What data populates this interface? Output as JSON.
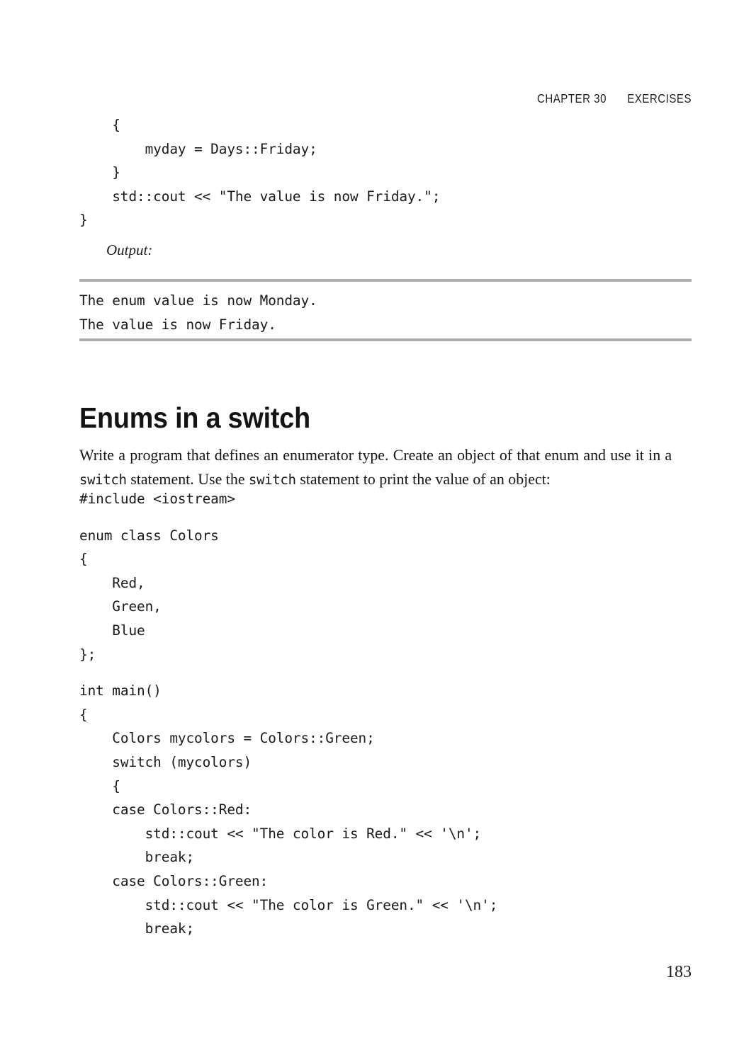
{
  "header": {
    "chapter": "CHAPTER 30",
    "section": "EXERCISES"
  },
  "code_top": {
    "lines": [
      "    {",
      "        myday = Days::Friday;",
      "    }",
      "    std::cout << \"The value is now Friday.\";",
      "}"
    ]
  },
  "output": {
    "label": "Output:",
    "lines": [
      "The enum value is now Monday.",
      "The value is now Friday."
    ],
    "rule_color": "#aeaeae"
  },
  "section": {
    "heading": "Enums in a switch",
    "paragraph": {
      "part1": "Write a program that defines an enumerator type. Create an object of that enum and use it in a ",
      "code1": "switch",
      "part2": " statement. Use the ",
      "code2": "switch",
      "part3": " statement to print the value of an object:"
    }
  },
  "code_main": {
    "lines": [
      "#include <iostream>",
      "",
      "enum class Colors",
      "{",
      "    Red,",
      "    Green,",
      "    Blue",
      "};",
      "",
      "int main()",
      "{",
      "    Colors mycolors = Colors::Green;",
      "    switch (mycolors)",
      "    {",
      "    case Colors::Red:",
      "        std::cout << \"The color is Red.\" << '\\n';",
      "        break;",
      "    case Colors::Green:",
      "        std::cout << \"The color is Green.\" << '\\n';",
      "        break;"
    ]
  },
  "folio": {
    "page_number": "183"
  }
}
